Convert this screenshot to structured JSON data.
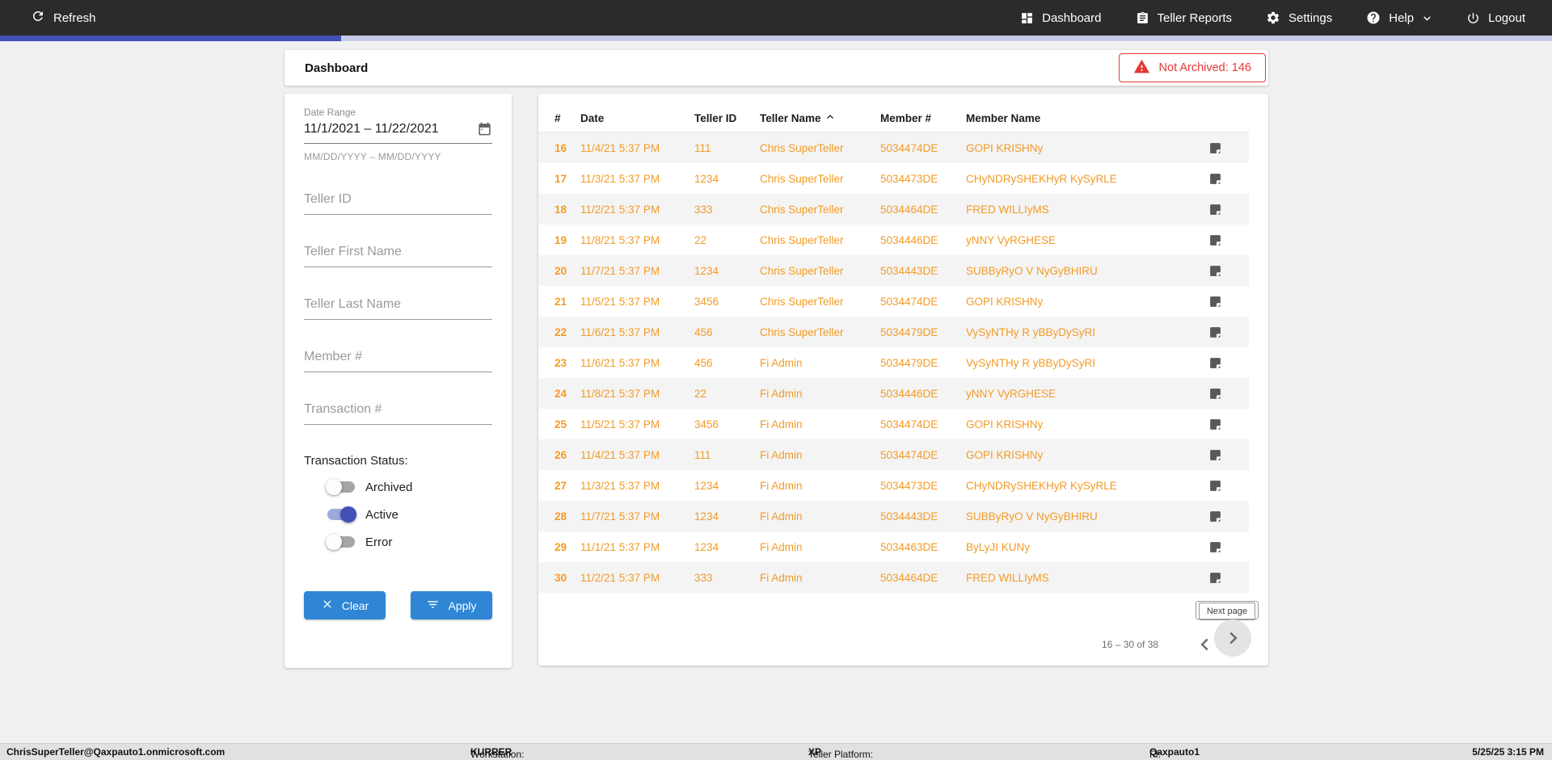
{
  "topbar": {
    "refresh_label": "Refresh",
    "nav": [
      {
        "label": "Dashboard",
        "icon": "dashboard-icon"
      },
      {
        "label": "Teller Reports",
        "icon": "clipboard-icon"
      },
      {
        "label": "Settings",
        "icon": "gear-icon"
      },
      {
        "label": "Help",
        "icon": "help-icon"
      },
      {
        "label": "Logout",
        "icon": "power-icon"
      }
    ]
  },
  "progress": {
    "percent": 22
  },
  "header": {
    "title": "Dashboard",
    "not_archived_label": "Not Archived: 146"
  },
  "filters": {
    "date_range": {
      "label": "Date Range",
      "value": "11/1/2021 – 11/22/2021",
      "helper": "MM/DD/YYYY – MM/DD/YYYY"
    },
    "fields": [
      {
        "placeholder": "Teller ID"
      },
      {
        "placeholder": "Teller First Name"
      },
      {
        "placeholder": "Teller Last Name"
      },
      {
        "placeholder": "Member #"
      },
      {
        "placeholder": "Transaction #"
      }
    ],
    "status_label": "Transaction Status:",
    "toggles": [
      {
        "label": "Archived",
        "on": false
      },
      {
        "label": "Active",
        "on": true
      },
      {
        "label": "Error",
        "on": false
      }
    ],
    "clear_label": "Clear",
    "apply_label": "Apply"
  },
  "table": {
    "columns": [
      "#",
      "Date",
      "Teller ID",
      "Teller Name",
      "Member #",
      "Member Name"
    ],
    "sorted_column": "Teller Name",
    "sort_direction": "asc",
    "rows": [
      {
        "num": "16",
        "date": "11/4/21 5:37 PM",
        "teller_id": "111",
        "teller_name": "Chris SuperTeller",
        "member_num": "5034474DE",
        "member_name": "GOPI KRISHNy"
      },
      {
        "num": "17",
        "date": "11/3/21 5:37 PM",
        "teller_id": "1234",
        "teller_name": "Chris SuperTeller",
        "member_num": "5034473DE",
        "member_name": "CHyNDRySHEKHyR KySyRLE"
      },
      {
        "num": "18",
        "date": "11/2/21 5:37 PM",
        "teller_id": "333",
        "teller_name": "Chris SuperTeller",
        "member_num": "5034464DE",
        "member_name": "FRED WILLIyMS"
      },
      {
        "num": "19",
        "date": "11/8/21 5:37 PM",
        "teller_id": "22",
        "teller_name": "Chris SuperTeller",
        "member_num": "5034446DE",
        "member_name": "yNNY VyRGHESE"
      },
      {
        "num": "20",
        "date": "11/7/21 5:37 PM",
        "teller_id": "1234",
        "teller_name": "Chris SuperTeller",
        "member_num": "5034443DE",
        "member_name": "SUBByRyO V NyGyBHIRU"
      },
      {
        "num": "21",
        "date": "11/5/21 5:37 PM",
        "teller_id": "3456",
        "teller_name": "Chris SuperTeller",
        "member_num": "5034474DE",
        "member_name": "GOPI KRISHNy"
      },
      {
        "num": "22",
        "date": "11/6/21 5:37 PM",
        "teller_id": "456",
        "teller_name": "Chris SuperTeller",
        "member_num": "5034479DE",
        "member_name": "VySyNTHy R yBByDySyRI"
      },
      {
        "num": "23",
        "date": "11/6/21 5:37 PM",
        "teller_id": "456",
        "teller_name": "Fi Admin",
        "member_num": "5034479DE",
        "member_name": "VySyNTHy R yBByDySyRI"
      },
      {
        "num": "24",
        "date": "11/8/21 5:37 PM",
        "teller_id": "22",
        "teller_name": "Fi Admin",
        "member_num": "5034446DE",
        "member_name": "yNNY VyRGHESE"
      },
      {
        "num": "25",
        "date": "11/5/21 5:37 PM",
        "teller_id": "3456",
        "teller_name": "Fi Admin",
        "member_num": "5034474DE",
        "member_name": "GOPI KRISHNy"
      },
      {
        "num": "26",
        "date": "11/4/21 5:37 PM",
        "teller_id": "111",
        "teller_name": "Fi Admin",
        "member_num": "5034474DE",
        "member_name": "GOPI KRISHNy"
      },
      {
        "num": "27",
        "date": "11/3/21 5:37 PM",
        "teller_id": "1234",
        "teller_name": "Fi Admin",
        "member_num": "5034473DE",
        "member_name": "CHyNDRySHEKHyR KySyRLE"
      },
      {
        "num": "28",
        "date": "11/7/21 5:37 PM",
        "teller_id": "1234",
        "teller_name": "Fi Admin",
        "member_num": "5034443DE",
        "member_name": "SUBByRyO V NyGyBHIRU"
      },
      {
        "num": "29",
        "date": "11/1/21 5:37 PM",
        "teller_id": "1234",
        "teller_name": "Fi Admin",
        "member_num": "5034463DE",
        "member_name": "ByLyJI KUNy"
      },
      {
        "num": "30",
        "date": "11/2/21 5:37 PM",
        "teller_id": "333",
        "teller_name": "Fi Admin",
        "member_num": "5034464DE",
        "member_name": "FRED WILLIyMS"
      }
    ]
  },
  "pagination": {
    "next_button_label": "Next page",
    "range_text": "16 – 30 of 38"
  },
  "statusbar": {
    "user": "ChrisSuperTeller@Qaxpauto1.onmicrosoft.com",
    "workstation_label": "Workstation:",
    "workstation_value": "KURRER",
    "platform_label": "Teller Platform:",
    "platform_value": "XP",
    "fi_label": "FI:",
    "fi_value": "Qaxpauto1",
    "datetime": "5/25/25 3:15 PM"
  },
  "colors": {
    "topbar_bg": "#2b2b2b",
    "progress_fill": "#3f51b5",
    "progress_track": "#c7cbe8",
    "accent_orange": "#f49b25",
    "button_blue": "#2e86d5",
    "toggle_on": "#3f51b5",
    "alert_red": "#e53935",
    "page_bg": "#f1f1f1"
  }
}
